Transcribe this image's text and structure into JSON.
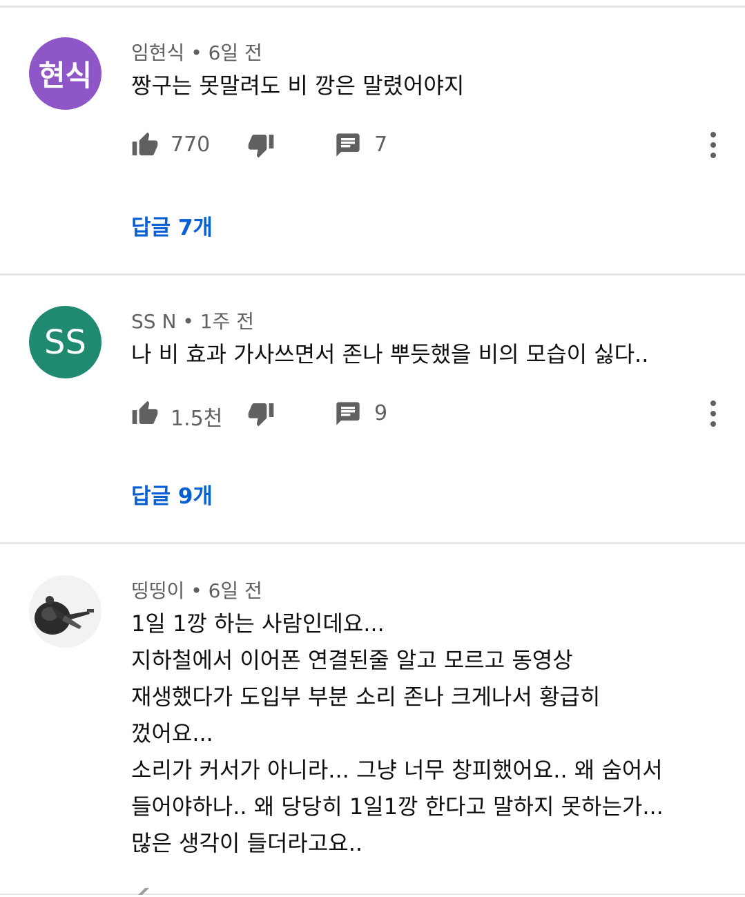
{
  "comments": [
    {
      "avatar_text": "현식",
      "avatar_color": "#8e56c7",
      "author": "임현식",
      "time": "6일 전",
      "lines": [
        "짱구는 못말려도 비 깡은 말렸어야지"
      ],
      "likes": "770",
      "reply_count": "7",
      "replies_label": "답글 7개"
    },
    {
      "avatar_text": "SS",
      "avatar_color": "#1f8a70",
      "author": "SS N",
      "time": "1주 전",
      "lines": [
        "나 비 효과 가사쓰면서 존나 뿌듯했을 비의 모습이 싫다.."
      ],
      "likes": "1.5천",
      "reply_count": "9",
      "replies_label": "답글 9개"
    },
    {
      "avatar_text": "",
      "avatar_color": "#ffffff",
      "author": "띵띵이",
      "time": "6일 전",
      "lines": [
        "1일 1깡 하는 사람인데요...",
        "지하철에서 이어폰 연결된줄 알고 모르고 동영상",
        "재생했다가 도입부 부분 소리 존나 크게나서 황급히",
        "껐어요...",
        "소리가 커서가 아니라... 그냥 너무 창피했어요.. 왜 숨어서",
        "들어야하나.. 왜 당당히 1일1깡 한다고 말하지 못하는가...",
        "많은 생각이 들더라고요.."
      ]
    }
  ],
  "icons": {
    "like": "thumb-up-icon",
    "dislike": "thumb-down-icon",
    "reply": "comment-icon",
    "more": "more-vertical-icon"
  }
}
